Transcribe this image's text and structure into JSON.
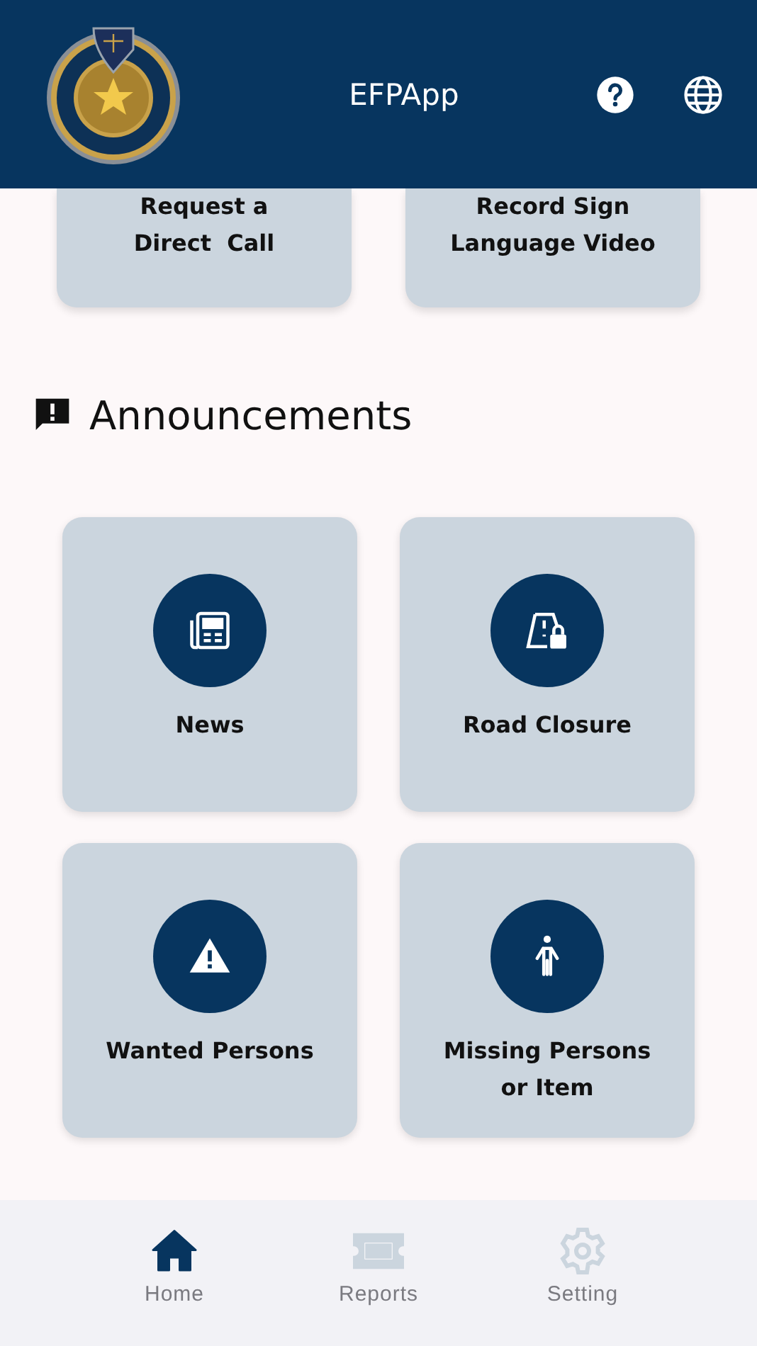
{
  "app_bar": {
    "title": "EFPApp"
  },
  "quick_actions": [
    {
      "label_lines": [
        "Request a",
        "Direct  Call"
      ]
    },
    {
      "label_lines": [
        "Record Sign",
        "Language Video"
      ]
    }
  ],
  "section": {
    "title": "Announcements"
  },
  "tiles": [
    {
      "kind": "news",
      "label_lines": [
        "News"
      ]
    },
    {
      "kind": "road",
      "label_lines": [
        "Road Closure"
      ]
    },
    {
      "kind": "wanted",
      "label_lines": [
        "Wanted Persons"
      ]
    },
    {
      "kind": "missing",
      "label_lines": [
        "Missing Persons",
        "or Item"
      ]
    }
  ],
  "nav": [
    {
      "kind": "home",
      "label": "Home",
      "selected": true
    },
    {
      "kind": "reports",
      "label": "Reports",
      "selected": false
    },
    {
      "kind": "setting",
      "label": "Setting",
      "selected": false
    }
  ]
}
